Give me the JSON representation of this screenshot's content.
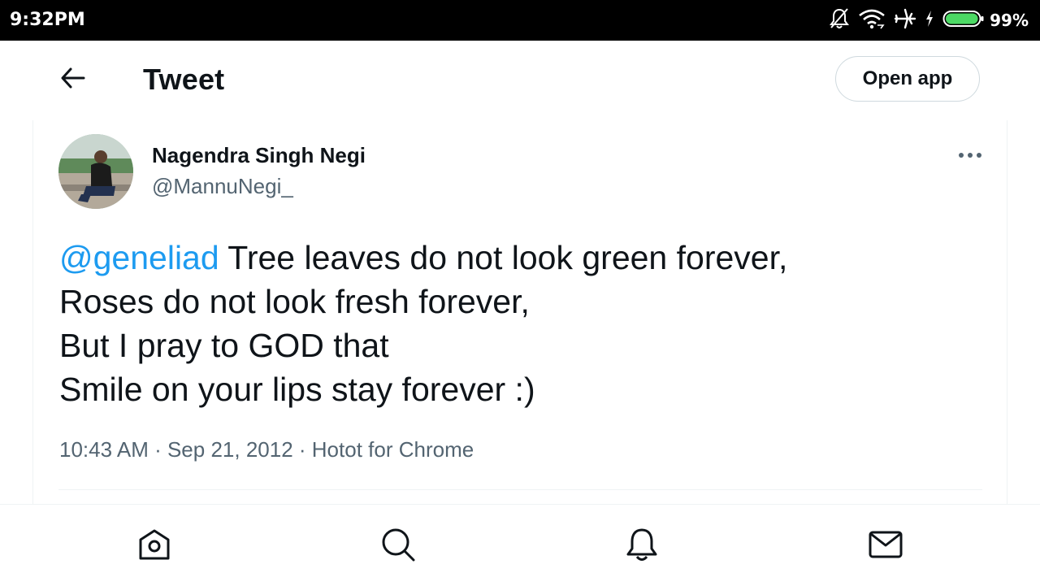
{
  "status_bar": {
    "time": "9:32PM",
    "battery_percent": "99%",
    "battery_level": 0.99,
    "icons": [
      "bell-off-icon",
      "wifi-icon",
      "airplane-icon",
      "charging-bolt-icon",
      "battery-icon"
    ]
  },
  "header": {
    "title": "Tweet",
    "back_icon": "arrow-left-icon",
    "open_app_label": "Open app"
  },
  "tweet": {
    "author_name": "Nagendra Singh Negi",
    "author_handle": "@MannuNegi_",
    "mention": "@geneliad",
    "text_lines": [
      " Tree leaves do not look green forever,",
      "Roses do not look fresh forever,",
      "But I pray to GOD that",
      "Smile on your lips stay forever :)"
    ],
    "time": "10:43 AM",
    "date": "Sep 21, 2012",
    "source": "Hotot for Chrome",
    "separator": " · "
  },
  "bottom_nav": {
    "items": [
      "home-icon",
      "search-icon",
      "notifications-icon",
      "messages-icon"
    ]
  },
  "colors": {
    "accent": "#1d9bf0",
    "text": "#0f1419",
    "secondary_text": "#536471",
    "border": "#eff3f4",
    "status_bar_bg": "#000000"
  }
}
